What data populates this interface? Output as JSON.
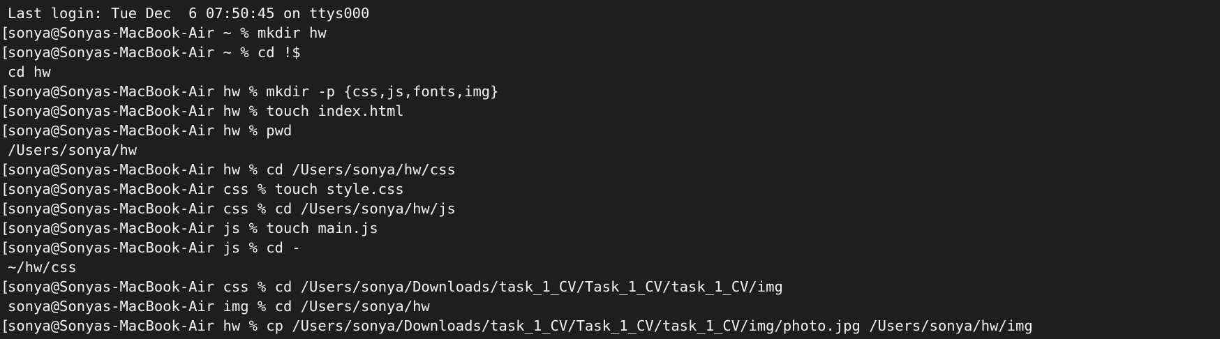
{
  "terminal": {
    "bracket": "[",
    "lines": [
      {
        "marked": false,
        "text": "Last login: Tue Dec  6 07:50:45 on ttys000"
      },
      {
        "marked": true,
        "text": "sonya@Sonyas-MacBook-Air ~ % mkdir hw"
      },
      {
        "marked": true,
        "text": "sonya@Sonyas-MacBook-Air ~ % cd !$"
      },
      {
        "marked": false,
        "text": "cd hw"
      },
      {
        "marked": true,
        "text": "sonya@Sonyas-MacBook-Air hw % mkdir -p {css,js,fonts,img}"
      },
      {
        "marked": true,
        "text": "sonya@Sonyas-MacBook-Air hw % touch index.html"
      },
      {
        "marked": true,
        "text": "sonya@Sonyas-MacBook-Air hw % pwd"
      },
      {
        "marked": false,
        "text": "/Users/sonya/hw"
      },
      {
        "marked": true,
        "text": "sonya@Sonyas-MacBook-Air hw % cd /Users/sonya/hw/css"
      },
      {
        "marked": true,
        "text": "sonya@Sonyas-MacBook-Air css % touch style.css"
      },
      {
        "marked": true,
        "text": "sonya@Sonyas-MacBook-Air css % cd /Users/sonya/hw/js"
      },
      {
        "marked": true,
        "text": "sonya@Sonyas-MacBook-Air js % touch main.js"
      },
      {
        "marked": true,
        "text": "sonya@Sonyas-MacBook-Air js % cd -"
      },
      {
        "marked": false,
        "text": "~/hw/css"
      },
      {
        "marked": true,
        "text": "sonya@Sonyas-MacBook-Air css % cd /Users/sonya/Downloads/task_1_CV/Task_1_CV/task_1_CV/img"
      },
      {
        "marked": false,
        "text": "sonya@Sonyas-MacBook-Air img % cd /Users/sonya/hw"
      },
      {
        "marked": true,
        "text": "sonya@Sonyas-MacBook-Air hw % cp /Users/sonya/Downloads/task_1_CV/Task_1_CV/task_1_CV/img/photo.jpg /Users/sonya/hw/img"
      }
    ]
  }
}
